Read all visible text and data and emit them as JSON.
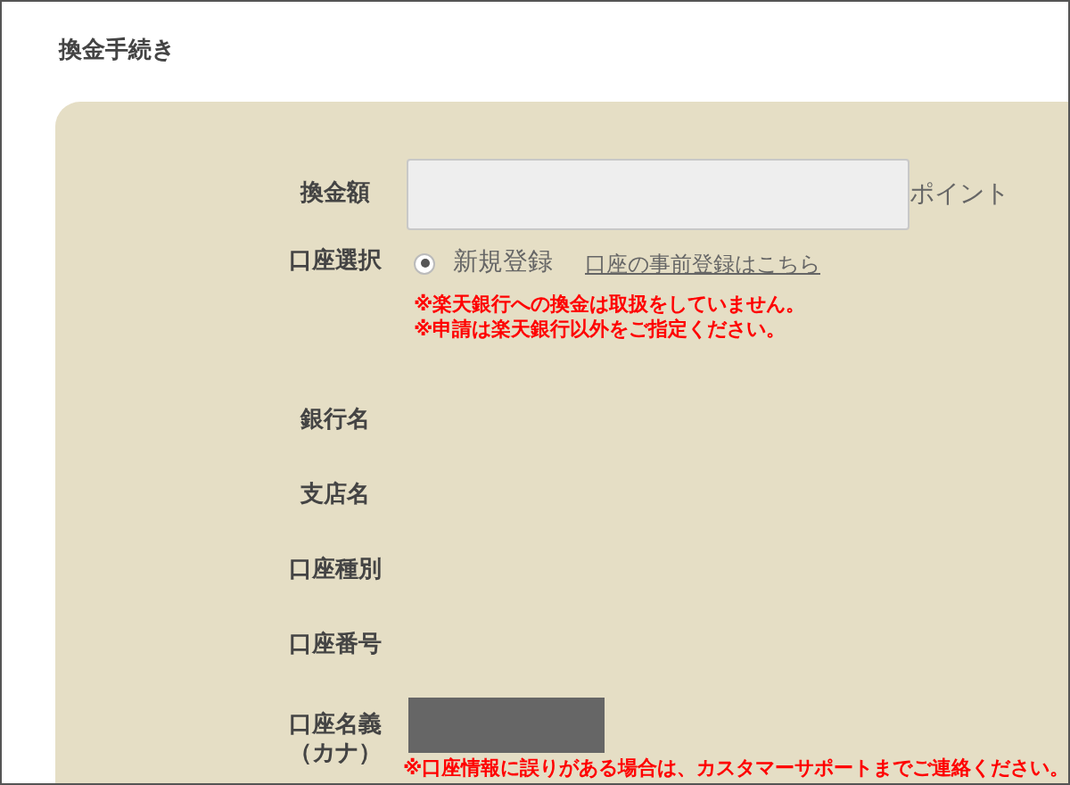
{
  "title": "換金手続き",
  "fields": [
    {
      "kind": "amount",
      "label": "換金額",
      "unit": "ポイント"
    },
    {
      "kind": "account_choice",
      "label": "口座選択",
      "option": {
        "label": "新規登録",
        "selected": true
      },
      "link": "口座の事前登録はこちら",
      "notes": [
        "※楽天銀行への換金は取扱をしていません。",
        "※申請は楽天銀行以外をご指定ください。"
      ]
    },
    {
      "kind": "empty",
      "label": "銀行名"
    },
    {
      "kind": "empty",
      "label": "支店名"
    },
    {
      "kind": "empty",
      "label": "口座種別"
    },
    {
      "kind": "empty",
      "label": "口座番号"
    },
    {
      "kind": "redacted",
      "label_lines": [
        "口座名義",
        "（カナ）"
      ],
      "notes": [
        "※口座情報に誤りがある場合は、カスタマーサポートまでご連絡ください。"
      ]
    }
  ]
}
